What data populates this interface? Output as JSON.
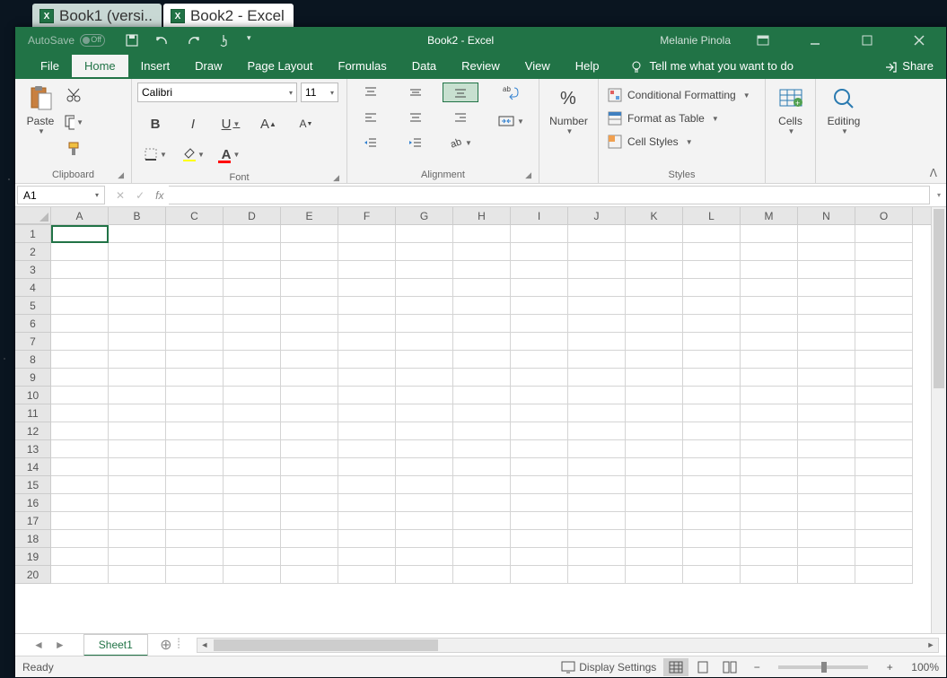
{
  "window_tabs": [
    {
      "label": "Book1 (versi.."
    },
    {
      "label": "Book2 - Excel"
    }
  ],
  "titlebar": {
    "autosave": "AutoSave",
    "autosave_state": "Off",
    "title": "Book2  -  Excel",
    "user": "Melanie Pinola"
  },
  "menu": {
    "items": [
      "File",
      "Home",
      "Insert",
      "Draw",
      "Page Layout",
      "Formulas",
      "Data",
      "Review",
      "View",
      "Help"
    ],
    "active": "Home",
    "tellme": "Tell me what you want to do",
    "share": "Share"
  },
  "ribbon": {
    "clipboard": {
      "paste": "Paste",
      "label": "Clipboard"
    },
    "font": {
      "name": "Calibri",
      "size": "11",
      "label": "Font",
      "bold": "B",
      "italic": "I",
      "underline": "U"
    },
    "alignment": {
      "label": "Alignment"
    },
    "number": {
      "btn": "Number",
      "label": "Number"
    },
    "styles": {
      "cond": "Conditional Formatting",
      "table": "Format as Table",
      "cell": "Cell Styles",
      "label": "Styles"
    },
    "cells": {
      "btn": "Cells"
    },
    "editing": {
      "btn": "Editing"
    }
  },
  "formula_bar": {
    "namebox": "A1"
  },
  "grid": {
    "columns": [
      "A",
      "B",
      "C",
      "D",
      "E",
      "F",
      "G",
      "H",
      "I",
      "J",
      "K",
      "L",
      "M",
      "N",
      "O"
    ],
    "rows": [
      1,
      2,
      3,
      4,
      5,
      6,
      7,
      8,
      9,
      10,
      11,
      12,
      13,
      14,
      15,
      16,
      17,
      18,
      19,
      20
    ],
    "active_cell": "A1"
  },
  "sheet_bar": {
    "sheet": "Sheet1"
  },
  "statusbar": {
    "ready": "Ready",
    "display": "Display Settings",
    "zoom": "100%"
  }
}
